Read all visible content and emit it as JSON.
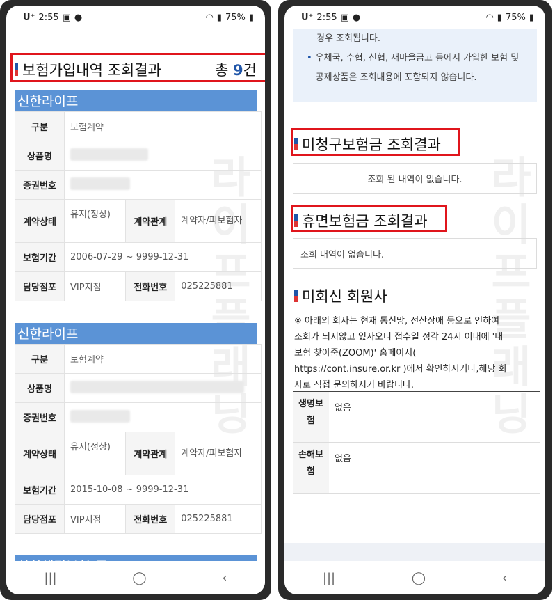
{
  "status": {
    "carrier": "U⁺",
    "time": "2:55",
    "battery": "75%"
  },
  "left": {
    "title": "보험가입내역 조회결과",
    "total_prefix": "총 ",
    "total_count": "9",
    "total_suffix": "건",
    "cards": [
      {
        "company": "신한라이프",
        "type": "보험계약",
        "status": "유지(정상)",
        "relation": "계약자/피보험자",
        "period": "2006-07-29 ~ 9999-12-31",
        "branch": "VIP지점",
        "phone": "025225881"
      },
      {
        "company": "신한라이프",
        "type": "보험계약",
        "status": "유지(정상)",
        "relation": "계약자/피보험자",
        "period": "2015-10-08 ~ 9999-12-31",
        "branch": "VIP지점",
        "phone": "025225881"
      }
    ],
    "labels": {
      "type": "구분",
      "product": "상품명",
      "cert": "증권번호",
      "status": "계약상태",
      "relation": "계약관계",
      "period": "보험기간",
      "branch": "담당점포",
      "phone": "전화번호"
    },
    "next_company_partial": "한화생명보험(주)"
  },
  "right": {
    "notice_top": "경우 조회됩니다.",
    "notice_bullet": "우체국, 수협, 신협, 새마을금고 등에서 가입한 보험 및 공제상품은 조회내용에 포함되지 않습니다.",
    "unclaimed_title": "미청구보험금 조회결과",
    "unclaimed_empty": "조회 된 내역이 없습니다.",
    "dormant_title": "휴면보험금 조회결과",
    "dormant_empty": "조회 내역이 없습니다.",
    "nonresp_title": "미회신 회원사",
    "nonresp_text": "※ 아래의 회사는 현재 통신망, 전산장애 등으로 인하여 조회가 되지않고 있사오니 접수일 정각 24시 이내에 '내 보험 찾아줌(ZOOM)' 홈페이지( https://cont.insure.or.kr )에서 확인하시거나,해당 회사로 직접 문의하시기 바랍니다.",
    "life_label": "생명보험",
    "life_value": "없음",
    "nonlife_label": "손해보험",
    "nonlife_value": "없음"
  },
  "watermark": "라이프플래닝"
}
